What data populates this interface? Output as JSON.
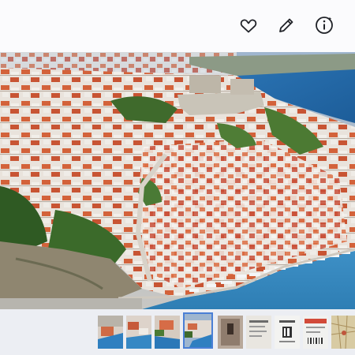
{
  "toolbar": {
    "icons": [
      "heart-icon",
      "pencil-icon",
      "info-icon",
      "more-icon"
    ]
  },
  "photo": {
    "subject": "aerial-coastal-town"
  },
  "filmstrip": {
    "faint_label": "",
    "thumbnails": [
      {
        "kind": "coastal-town"
      },
      {
        "kind": "coastal-town"
      },
      {
        "kind": "coastal-town"
      },
      {
        "kind": "coastal-town",
        "selected": true
      },
      {
        "kind": "dark-photo"
      },
      {
        "kind": "document"
      },
      {
        "kind": "ticket"
      },
      {
        "kind": "ticket"
      },
      {
        "kind": "map"
      }
    ]
  },
  "colors": {
    "accent": "#4a7fd6",
    "sea": "#2f7fc0"
  }
}
